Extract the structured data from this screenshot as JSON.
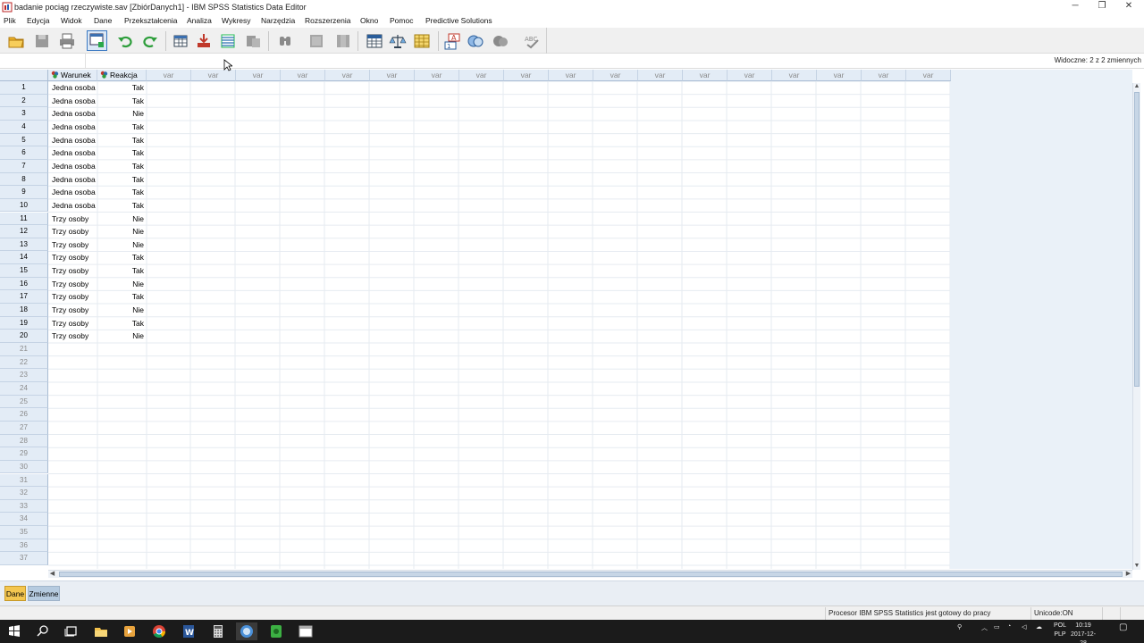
{
  "window": {
    "title": "badanie pociąg rzeczywiste.sav [ZbiórDanych1] - IBM SPSS Statistics Data Editor",
    "minimize_label": "─",
    "maximize_label": "❐",
    "close_label": "✕"
  },
  "menu": [
    {
      "label": "Plik"
    },
    {
      "label": "Edycja"
    },
    {
      "label": "Widok"
    },
    {
      "label": "Dane"
    },
    {
      "label": "Przekształcenia"
    },
    {
      "label": "Analiza"
    },
    {
      "label": "Wykresy"
    },
    {
      "label": "Narzędzia"
    },
    {
      "label": "Rozszerzenia"
    },
    {
      "label": "Okno"
    },
    {
      "label": "Pomoc"
    },
    {
      "label": "Predictive Solutions"
    }
  ],
  "toolbar": {
    "icons": [
      "open-folder-icon",
      "save-icon",
      "print-icon",
      "dialog-recall-icon",
      "undo-icon",
      "redo-icon",
      "goto-case-icon",
      "goto-variable-icon",
      "variables-icon",
      "run-descriptives-icon",
      "find-icon",
      "insert-cases-icon",
      "insert-variable-icon",
      "split-file-icon",
      "weight-cases-icon",
      "select-cases-icon",
      "value-labels-icon",
      "use-sets-icon",
      "show-all-variables-icon",
      "spell-check-icon"
    ]
  },
  "cellbar": {
    "cell_ref": "",
    "visible_variables": "Widoczne: 2 z 2 zmiennych"
  },
  "grid": {
    "variables": [
      {
        "name": "Warunek",
        "measure": "nominal"
      },
      {
        "name": "Reakcja",
        "measure": "nominal"
      }
    ],
    "empty_column_label": "var",
    "empty_column_count": 18,
    "rows": [
      {
        "n": "1",
        "warunek": "Jedna osoba",
        "reakcja": "Tak"
      },
      {
        "n": "2",
        "warunek": "Jedna osoba",
        "reakcja": "Tak"
      },
      {
        "n": "3",
        "warunek": "Jedna osoba",
        "reakcja": "Nie"
      },
      {
        "n": "4",
        "warunek": "Jedna osoba",
        "reakcja": "Tak"
      },
      {
        "n": "5",
        "warunek": "Jedna osoba",
        "reakcja": "Tak"
      },
      {
        "n": "6",
        "warunek": "Jedna osoba",
        "reakcja": "Tak"
      },
      {
        "n": "7",
        "warunek": "Jedna osoba",
        "reakcja": "Tak"
      },
      {
        "n": "8",
        "warunek": "Jedna osoba",
        "reakcja": "Tak"
      },
      {
        "n": "9",
        "warunek": "Jedna osoba",
        "reakcja": "Tak"
      },
      {
        "n": "10",
        "warunek": "Jedna osoba",
        "reakcja": "Tak"
      },
      {
        "n": "11",
        "warunek": "Trzy osoby",
        "reakcja": "Nie"
      },
      {
        "n": "12",
        "warunek": "Trzy osoby",
        "reakcja": "Nie"
      },
      {
        "n": "13",
        "warunek": "Trzy osoby",
        "reakcja": "Nie"
      },
      {
        "n": "14",
        "warunek": "Trzy osoby",
        "reakcja": "Tak"
      },
      {
        "n": "15",
        "warunek": "Trzy osoby",
        "reakcja": "Tak"
      },
      {
        "n": "16",
        "warunek": "Trzy osoby",
        "reakcja": "Nie"
      },
      {
        "n": "17",
        "warunek": "Trzy osoby",
        "reakcja": "Tak"
      },
      {
        "n": "18",
        "warunek": "Trzy osoby",
        "reakcja": "Nie"
      },
      {
        "n": "19",
        "warunek": "Trzy osoby",
        "reakcja": "Tak"
      },
      {
        "n": "20",
        "warunek": "Trzy osoby",
        "reakcja": "Nie"
      }
    ],
    "empty_rows": [
      "21",
      "22",
      "23",
      "24",
      "25",
      "26",
      "27",
      "28",
      "29",
      "30",
      "31",
      "32",
      "33",
      "34",
      "35",
      "36",
      "37"
    ]
  },
  "tabs": [
    {
      "label": "Dane",
      "active": true
    },
    {
      "label": "Zmienne",
      "active": false
    }
  ],
  "statusbar": {
    "processor": "Procesor IBM SPSS Statistics  jest gotowy do pracy",
    "unicode": "Unicode:ON"
  },
  "taskbar": {
    "apps": [
      "windows-start-icon",
      "search-icon",
      "task-view-icon",
      "file-explorer-icon",
      "media-player-icon",
      "chrome-icon",
      "word-icon",
      "calculator-icon",
      "spss-icon",
      "green-app-icon",
      "window-icon"
    ],
    "language_top": "POL",
    "language_bottom": "PLP",
    "time": "10:19",
    "date": "2017-12-28"
  },
  "colors": {
    "header_bg": "#e3ecf6",
    "active_tab": "#f4c650",
    "inactive_tab": "#b6cbe0",
    "taskbar": "#1b1b1b"
  }
}
